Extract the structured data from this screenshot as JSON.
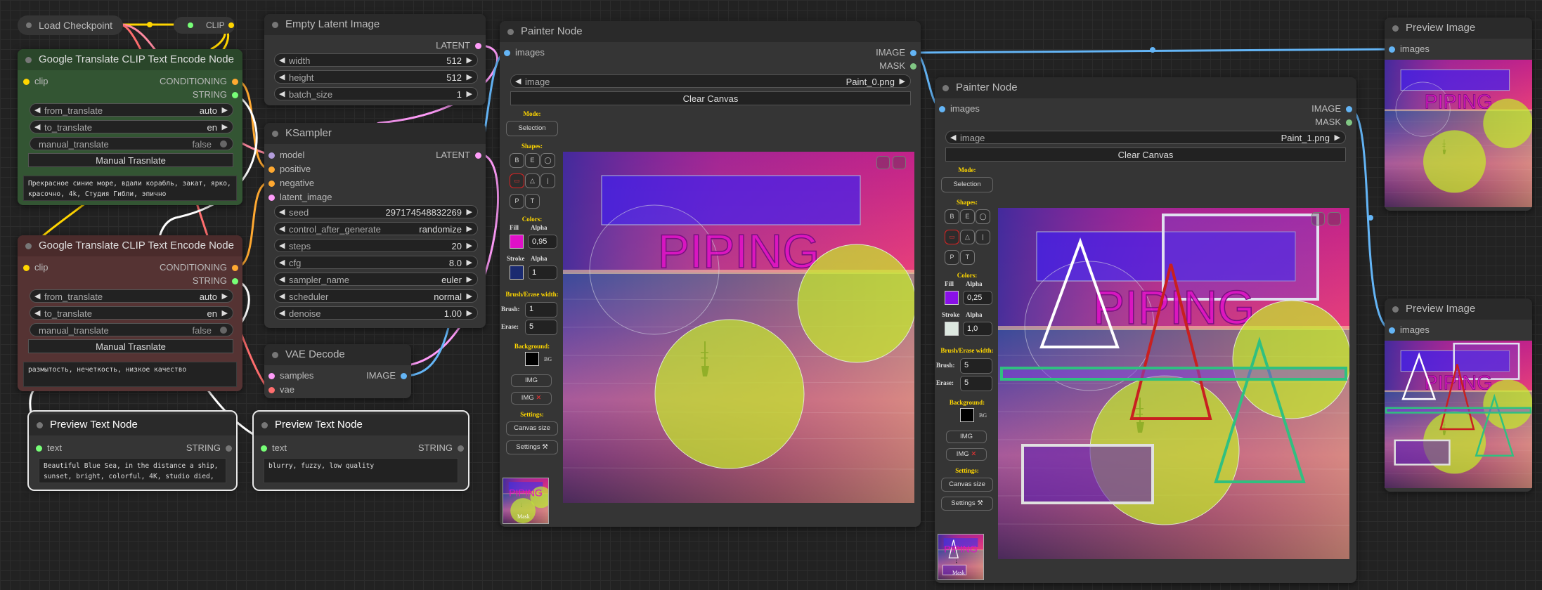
{
  "canvas_text": "PIPING",
  "load_checkpoint": {
    "title": "Load Checkpoint",
    "clip_label": "CLIP"
  },
  "translate_pos": {
    "title": "Google Translate CLIP Text Encode Node",
    "in_clip": "clip",
    "out_cond": "CONDITIONING",
    "out_string": "STRING",
    "from_translate_label": "from_translate",
    "from_translate_value": "auto",
    "to_translate_label": "to_translate",
    "to_translate_value": "en",
    "manual_label": "manual_translate",
    "manual_value": "false",
    "button": "Manual Trasnlate",
    "text": "Прекрасное синие море, вдали корабль, закат, ярко, красочно, 4k, Студия Гибли, эпично"
  },
  "translate_neg": {
    "title": "Google Translate CLIP Text Encode Node",
    "in_clip": "clip",
    "out_cond": "CONDITIONING",
    "out_string": "STRING",
    "from_translate_label": "from_translate",
    "from_translate_value": "auto",
    "to_translate_label": "to_translate",
    "to_translate_value": "en",
    "manual_label": "manual_translate",
    "manual_value": "false",
    "button": "Manual Trasnlate",
    "text": "размытость, нечеткость, низкое качество"
  },
  "empty_latent": {
    "title": "Empty Latent Image",
    "out_latent": "LATENT",
    "width_label": "width",
    "width_value": "512",
    "height_label": "height",
    "height_value": "512",
    "batch_label": "batch_size",
    "batch_value": "1"
  },
  "ksampler": {
    "title": "KSampler",
    "in_model": "model",
    "in_positive": "positive",
    "in_negative": "negative",
    "in_latent": "latent_image",
    "out_latent": "LATENT",
    "seed_label": "seed",
    "seed_value": "297174548832269",
    "control_label": "control_after_generate",
    "control_value": "randomize",
    "steps_label": "steps",
    "steps_value": "20",
    "cfg_label": "cfg",
    "cfg_value": "8.0",
    "sampler_label": "sampler_name",
    "sampler_value": "euler",
    "scheduler_label": "scheduler",
    "scheduler_value": "normal",
    "denoise_label": "denoise",
    "denoise_value": "1.00"
  },
  "vae_decode": {
    "title": "VAE Decode",
    "in_samples": "samples",
    "in_vae": "vae",
    "out_image": "IMAGE"
  },
  "preview_text_1": {
    "title": "Preview Text Node",
    "in_text": "text",
    "out_string": "STRING",
    "text": "Beautiful Blue Sea, in the distance a ship, sunset, bright, colorful, 4K, studio died, epic"
  },
  "preview_text_2": {
    "title": "Preview Text Node",
    "in_text": "text",
    "out_string": "STRING",
    "text": "blurry, fuzzy, low quality"
  },
  "painter_1": {
    "title": "Painter Node",
    "in_images": "images",
    "out_image": "IMAGE",
    "out_mask": "MASK",
    "image_label": "image",
    "image_value": "Paint_0.png",
    "clear_button": "Clear Canvas",
    "mode_label": "Mode:",
    "mode_button": "Selection",
    "shapes_label": "Shapes:",
    "shape_b": "B",
    "shape_e": "E",
    "shape_p": "P",
    "shape_t": "T",
    "colors_label": "Colors:",
    "fill_label": "Fill",
    "alpha_label": "Alpha",
    "fill_color": "#e010c8",
    "fill_alpha": "0,95",
    "stroke_label": "Stroke",
    "stroke_color": "#1a2a70",
    "stroke_alpha": "1",
    "brush_width_label": "Brush/Erase width:",
    "brush_label": "Brush:",
    "brush_value": "1",
    "erase_label": "Erase:",
    "erase_value": "5",
    "background_label": "Background:",
    "bg_color": "#000000",
    "bg_text": "BG",
    "img_button": "IMG",
    "img_x_button": "IMG",
    "settings_label": "Settings:",
    "canvas_size_button": "Canvas size",
    "settings_button": "Settings",
    "thumb_label": "Mask"
  },
  "painter_2": {
    "title": "Painter Node",
    "in_images": "images",
    "out_image": "IMAGE",
    "out_mask": "MASK",
    "image_label": "image",
    "image_value": "Paint_1.png",
    "clear_button": "Clear Canvas",
    "mode_label": "Mode:",
    "mode_button": "Selection",
    "shapes_label": "Shapes:",
    "shape_b": "B",
    "shape_e": "E",
    "shape_p": "P",
    "shape_t": "T",
    "colors_label": "Colors:",
    "fill_label": "Fill",
    "alpha_label": "Alpha",
    "fill_color": "#8a10e8",
    "fill_alpha": "0,25",
    "stroke_label": "Stroke",
    "stroke_color": "#dde8e0",
    "stroke_alpha": "1,0",
    "brush_width_label": "Brush/Erase width:",
    "brush_label": "Brush:",
    "brush_value": "5",
    "erase_label": "Erase:",
    "erase_value": "5",
    "background_label": "Background:",
    "bg_color": "#000000",
    "bg_text": "BG",
    "img_button": "IMG",
    "img_x_button": "IMG",
    "settings_label": "Settings:",
    "canvas_size_button": "Canvas size",
    "settings_button": "Settings",
    "thumb_label": "Mask"
  },
  "preview_image_1": {
    "title": "Preview Image",
    "in_images": "images"
  },
  "preview_image_2": {
    "title": "Preview Image",
    "in_images": "images"
  },
  "colors": {
    "clip": "#ffd500",
    "conditioning": "#ffa931",
    "string": "#77ff77",
    "latent": "#ff9cf9",
    "image": "#64b5f6",
    "mask": "#81c784",
    "model": "#b39ddb",
    "vae": "#ff6e6e",
    "wire_text": "#ffffff"
  }
}
